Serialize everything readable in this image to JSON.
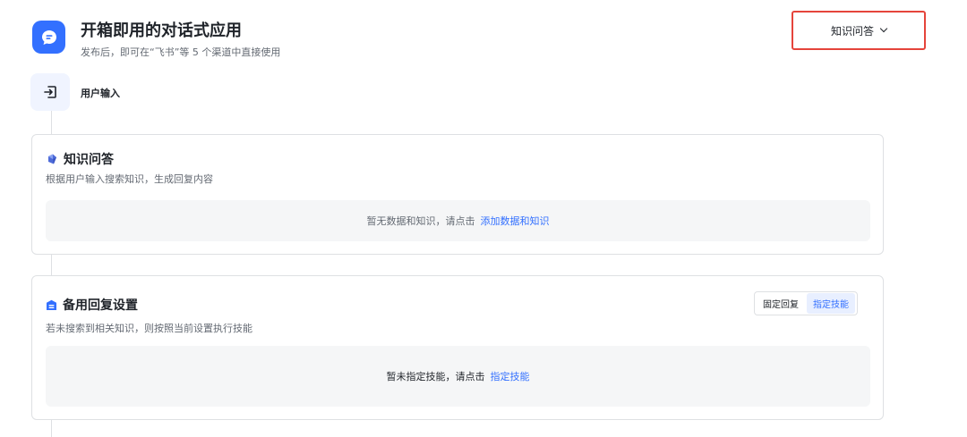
{
  "header": {
    "title": "开箱即用的对话式应用",
    "subtitle": "发布后，即可在“飞书”等 5 个渠道中直接使用",
    "mode_select_value": "知识问答"
  },
  "input_node": {
    "label": "用户输入"
  },
  "knowledge_qa_card": {
    "title": "知识问答",
    "description": "根据用户输入搜索知识，生成回复内容",
    "empty_text": "暂无数据和知识，请点击",
    "empty_link": "添加数据和知识"
  },
  "fallback_card": {
    "title": "备用回复设置",
    "description": "若未搜索到相关知识，则按照当前设置执行技能",
    "segment_options": [
      "固定回复",
      "指定技能"
    ],
    "segment_selected": "指定技能",
    "empty_text": "暂未指定技能，请点击",
    "empty_link": "指定技能"
  },
  "colors": {
    "accent": "#3370ff",
    "highlight_border": "#e5443b",
    "card_border": "#dee0e3",
    "empty_bg": "#f5f6f7",
    "kqa_icon": "#5a73d6",
    "fallback_icon": "#3370ff"
  },
  "icons": {
    "app": "chat-bubble-icon",
    "mode_select": "chevron-down-icon",
    "input_node": "login-arrow-icon",
    "kqa": "knowledge-gem-icon",
    "fallback": "fallback-box-icon"
  }
}
